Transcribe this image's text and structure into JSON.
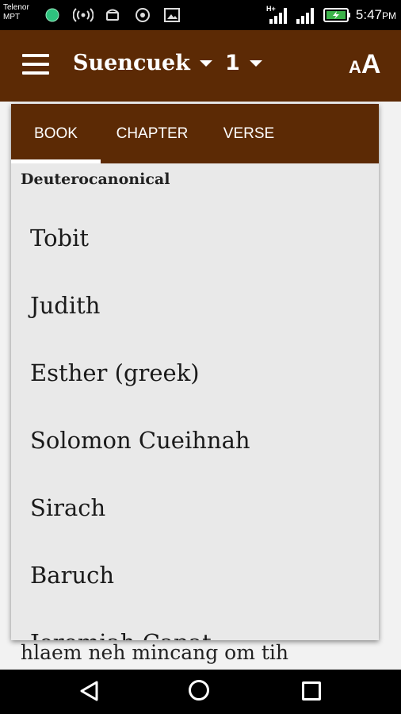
{
  "status": {
    "carrier_line1": "Telenor",
    "carrier_line2": "MPT",
    "time": "5:47",
    "ampm": "PM",
    "network": "H+"
  },
  "appbar": {
    "book": "Suencuek",
    "chapter": "1",
    "text_size_small": "A",
    "text_size_big": "A"
  },
  "popup": {
    "tabs": [
      "BOOK",
      "CHAPTER",
      "VERSE"
    ],
    "active_tab": "BOOK",
    "section": "Deuterocanonical",
    "books": [
      "Tobit",
      "Judith",
      "Esther (greek)",
      "Solomon Cueihnah",
      "Sirach",
      "Baruch",
      "Jeremiah Capat"
    ]
  },
  "content": {
    "visible_text": "hlaem neh mincang om tih"
  },
  "colors": {
    "primary": "#5c2a05",
    "popup_bg": "#e9e9e9"
  }
}
